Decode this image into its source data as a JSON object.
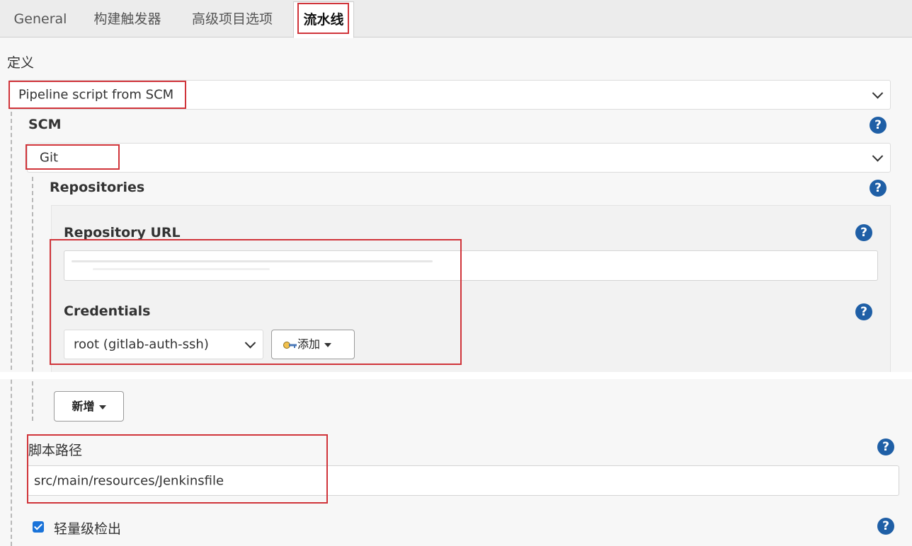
{
  "tabs": [
    {
      "label": "General"
    },
    {
      "label": "构建触发器"
    },
    {
      "label": "高级项目选项"
    },
    {
      "label": "流水线"
    }
  ],
  "definition": {
    "label": "定义",
    "selected": "Pipeline script from SCM"
  },
  "scm": {
    "label": "SCM",
    "selected": "Git"
  },
  "repositories": {
    "label": "Repositories",
    "url_label": "Repository URL",
    "url_value": "",
    "credentials_label": "Credentials",
    "credentials_selected": "root (gitlab-auth-ssh)",
    "add_button": "添加"
  },
  "new_button": "新增",
  "script_path": {
    "label": "脚本路径",
    "value": "src/main/resources/Jenkinsfile"
  },
  "lightweight": {
    "label": "轻量级检出",
    "checked": true
  },
  "icons": {
    "help": "?"
  },
  "colors": {
    "highlight": "#d0343a",
    "help_icon": "#1f5fa6",
    "checkbox": "#1a73d9"
  }
}
